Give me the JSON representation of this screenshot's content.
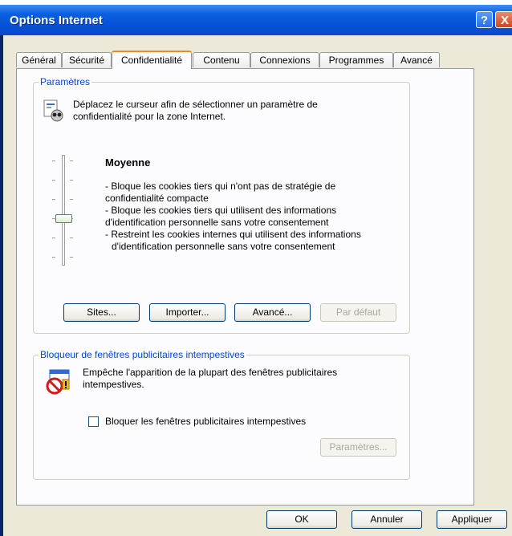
{
  "window": {
    "title": "Options Internet",
    "help_glyph": "?",
    "close_glyph": "X"
  },
  "tabs": [
    {
      "label": "Général"
    },
    {
      "label": "Sécurité"
    },
    {
      "label": "Confidentialité"
    },
    {
      "label": "Contenu"
    },
    {
      "label": "Connexions"
    },
    {
      "label": "Programmes"
    },
    {
      "label": "Avancé"
    }
  ],
  "active_tab": "Confidentialité",
  "settings": {
    "legend": "Paramètres",
    "intro_line1": "Déplacez le curseur afin de sélectionner un paramètre de",
    "intro_line2": "confidentialité pour la zone Internet.",
    "level_title": "Moyenne",
    "desc": [
      "- Bloque les cookies tiers qui n'ont pas de stratégie de",
      "confidentialité compacte",
      "- Bloque les cookies tiers qui utilisent des informations",
      "d'identification personnelle sans votre consentement",
      "- Restreint les cookies internes qui utilisent des informations",
      "  d'identification personnelle sans votre consentement"
    ],
    "slider_level": "Moyenne",
    "buttons": {
      "sites": "Sites...",
      "import": "Importer...",
      "advanced": "Avancé...",
      "default": "Par défaut"
    }
  },
  "popup_blocker": {
    "legend": "Bloqueur de fenêtres publicitaires intempestives",
    "desc_line1": "Empêche l'apparition de la plupart des fenêtres publicitaires",
    "desc_line2": "intempestives.",
    "checkbox_label": "Bloquer les fenêtres publicitaires intempestives",
    "checkbox_checked": false,
    "settings_button": "Paramètres..."
  },
  "footer": {
    "ok": "OK",
    "cancel": "Annuler",
    "apply": "Appliquer"
  }
}
